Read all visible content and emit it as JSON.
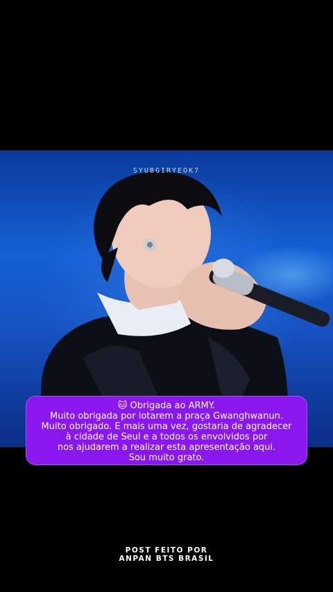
{
  "photo": {
    "watermark": "SYUBGIRYEOK7"
  },
  "caption": {
    "emoji": "🐱",
    "lines": [
      "Obrigada ao ARMY.",
      "Muito obrigada por lotarem a praça Gwanghwanun.",
      "Muito obrigado. E mais uma vez, gostaria de agradecer",
      "à cidade de Seul e a todos os envolvidos por",
      "nos ajudarem a realizar esta apresentação aqui.",
      "Sou muito grato."
    ],
    "background_color": "#8a17ee"
  },
  "footer": {
    "line1": "POST FEITO POR",
    "line2": "ANPAN BTS BRASIL"
  }
}
